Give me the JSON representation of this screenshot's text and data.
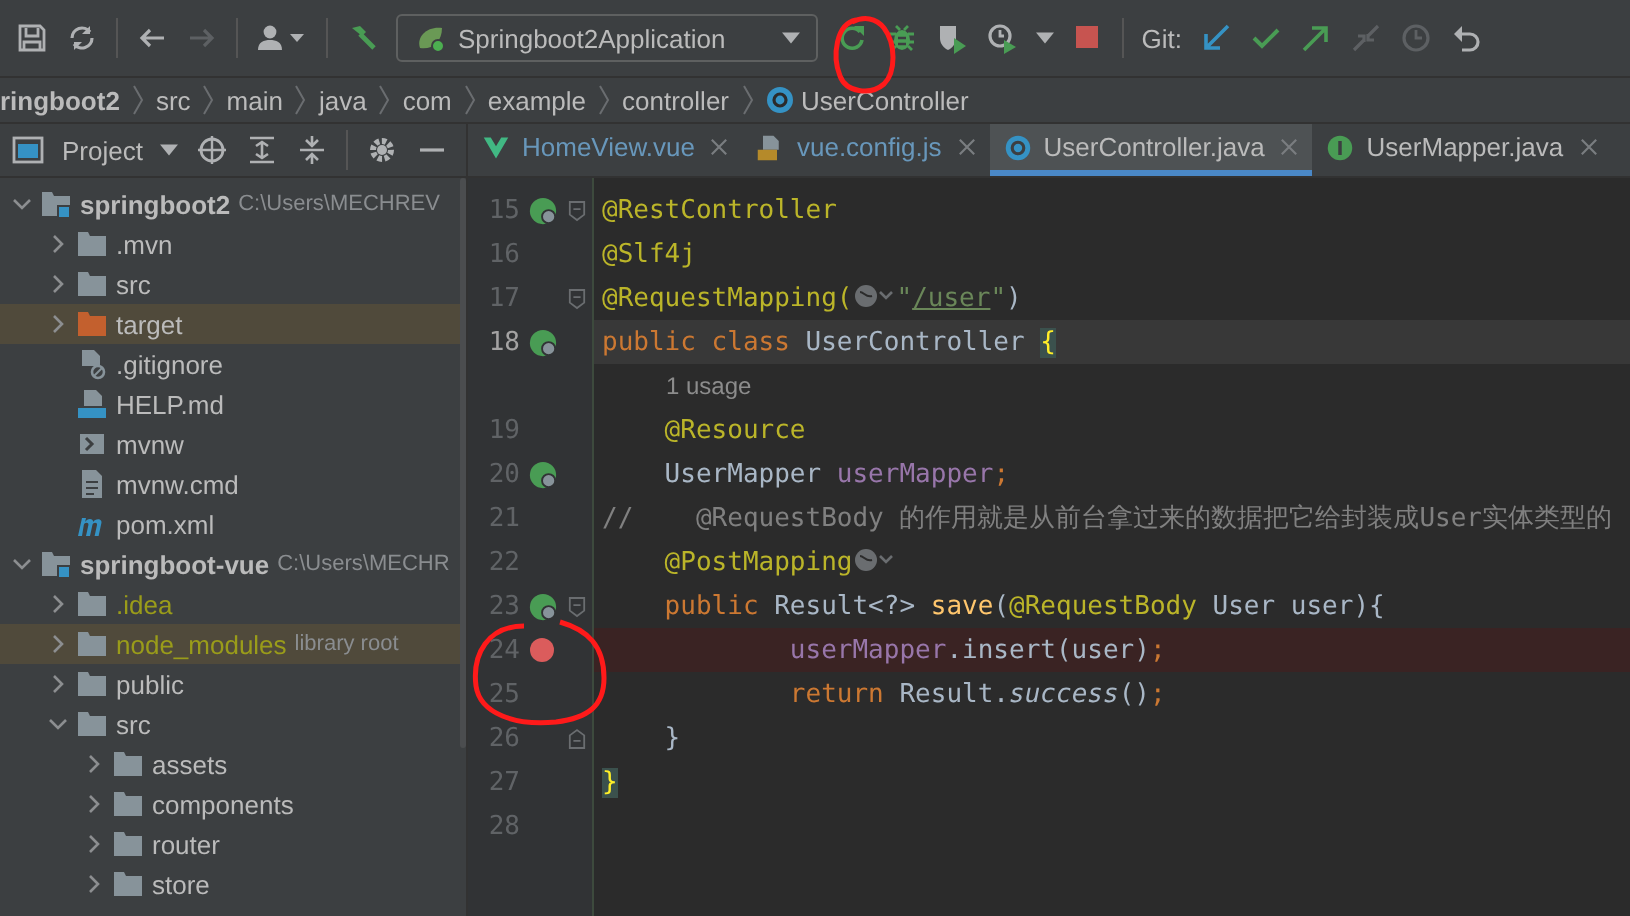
{
  "toolbar": {
    "run_configuration": "Springboot2Application",
    "vcs_label": "Git:"
  },
  "breadcrumbs": [
    {
      "label": "ringboot2",
      "kind": "project"
    },
    {
      "label": "src",
      "kind": "folder"
    },
    {
      "label": "main",
      "kind": "folder"
    },
    {
      "label": "java",
      "kind": "folder"
    },
    {
      "label": "com",
      "kind": "folder"
    },
    {
      "label": "example",
      "kind": "folder"
    },
    {
      "label": "controller",
      "kind": "folder"
    },
    {
      "label": "UserController",
      "kind": "class"
    }
  ],
  "project_panel": {
    "title": "Project"
  },
  "tree": [
    {
      "label": "springboot2",
      "kind": "module",
      "hint": "C:\\Users\\MECHREV",
      "expanded": true,
      "highlighted": false,
      "ignored": false,
      "children": [
        {
          "label": ".mvn",
          "kind": "folder",
          "expanded": false,
          "highlighted": false,
          "ignored": false
        },
        {
          "label": "src",
          "kind": "folder",
          "expanded": false,
          "highlighted": false,
          "ignored": false
        },
        {
          "label": "target",
          "kind": "excluded",
          "expanded": false,
          "highlighted": true,
          "ignored": false
        },
        {
          "label": ".gitignore",
          "kind": "ignore-file",
          "highlighted": false,
          "ignored": false
        },
        {
          "label": "HELP.md",
          "kind": "markdown",
          "highlighted": false,
          "ignored": false
        },
        {
          "label": "mvnw",
          "kind": "shell",
          "highlighted": false,
          "ignored": false
        },
        {
          "label": "mvnw.cmd",
          "kind": "text",
          "highlighted": false,
          "ignored": false
        },
        {
          "label": "pom.xml",
          "kind": "maven",
          "highlighted": false,
          "ignored": false
        }
      ]
    },
    {
      "label": "springboot-vue",
      "kind": "module",
      "hint": "C:\\Users\\MECHR",
      "expanded": true,
      "highlighted": false,
      "ignored": false,
      "children": [
        {
          "label": ".idea",
          "kind": "folder",
          "expanded": false,
          "highlighted": false,
          "ignored": true
        },
        {
          "label": "node_modules",
          "kind": "folder",
          "hint": "library root",
          "expanded": false,
          "highlighted": true,
          "ignored": true
        },
        {
          "label": "public",
          "kind": "folder",
          "expanded": false,
          "highlighted": false,
          "ignored": false
        },
        {
          "label": "src",
          "kind": "folder",
          "expanded": true,
          "highlighted": false,
          "ignored": false,
          "children": [
            {
              "label": "assets",
              "kind": "folder",
              "expanded": false,
              "highlighted": false,
              "ignored": false
            },
            {
              "label": "components",
              "kind": "folder",
              "expanded": false,
              "highlighted": false,
              "ignored": false
            },
            {
              "label": "router",
              "kind": "folder",
              "expanded": false,
              "highlighted": false,
              "ignored": false
            },
            {
              "label": "store",
              "kind": "folder",
              "expanded": false,
              "highlighted": false,
              "ignored": false
            }
          ]
        }
      ]
    }
  ],
  "tabs": [
    {
      "label": "HomeView.vue",
      "kind": "vue",
      "selected": false,
      "modified": true
    },
    {
      "label": "vue.config.js",
      "kind": "js",
      "selected": false,
      "modified": true
    },
    {
      "label": "UserController.java",
      "kind": "class",
      "selected": true,
      "modified": false
    },
    {
      "label": "UserMapper.java",
      "kind": "interface",
      "selected": false,
      "modified": false
    }
  ],
  "editor": {
    "lines": [
      {
        "kind": "code",
        "number": "15",
        "caret": false,
        "breakpoint": false,
        "marker": true,
        "fold_start": true,
        "fold_end": false,
        "tokens": [
          {
            "kind": "annotation",
            "text": "@RestController"
          }
        ]
      },
      {
        "kind": "code",
        "number": "16",
        "caret": false,
        "breakpoint": false,
        "marker": false,
        "fold_start": false,
        "fold_end": false,
        "tokens": [
          {
            "kind": "annotation",
            "text": "@Slf4j"
          }
        ]
      },
      {
        "kind": "code",
        "number": "17",
        "caret": false,
        "breakpoint": false,
        "marker": false,
        "fold_start": true,
        "fold_end": false,
        "tokens": [
          {
            "kind": "annotation",
            "text": "@RequestMapping("
          },
          {
            "kind": "globe"
          },
          {
            "kind": "string",
            "text": "\""
          },
          {
            "kind": "url",
            "text": "/user"
          },
          {
            "kind": "string",
            "text": "\""
          },
          {
            "kind": "plain",
            "text": ")"
          }
        ]
      },
      {
        "kind": "code",
        "number": "18",
        "caret": true,
        "breakpoint": false,
        "marker": true,
        "fold_start": false,
        "fold_end": false,
        "tokens": [
          {
            "kind": "keyword",
            "text": "public class "
          },
          {
            "kind": "plain",
            "text": "UserController "
          },
          {
            "kind": "brace",
            "text": "{"
          }
        ]
      },
      {
        "kind": "inlay",
        "text": "1 usage"
      },
      {
        "kind": "code",
        "number": "19",
        "caret": false,
        "breakpoint": false,
        "marker": false,
        "fold_start": false,
        "fold_end": false,
        "tokens": [
          {
            "kind": "annotation",
            "text": "    @Resource"
          }
        ]
      },
      {
        "kind": "code",
        "number": "20",
        "caret": false,
        "breakpoint": false,
        "marker": true,
        "fold_start": false,
        "fold_end": false,
        "tokens": [
          {
            "kind": "plain",
            "text": "    UserMapper "
          },
          {
            "kind": "field",
            "text": "userMapper"
          },
          {
            "kind": "keyword",
            "text": ";"
          }
        ]
      },
      {
        "kind": "code",
        "number": "21",
        "caret": false,
        "breakpoint": false,
        "marker": false,
        "fold_start": false,
        "fold_end": false,
        "tokens": [
          {
            "kind": "comment",
            "text": "//    @RequestBody 的作用就是从前台拿过来的数据把它给封装成User实体类型的"
          }
        ]
      },
      {
        "kind": "code",
        "number": "22",
        "caret": false,
        "breakpoint": false,
        "marker": false,
        "fold_start": false,
        "fold_end": false,
        "tokens": [
          {
            "kind": "annotation",
            "text": "    @PostMapping"
          },
          {
            "kind": "globe"
          }
        ]
      },
      {
        "kind": "code",
        "number": "23",
        "caret": false,
        "breakpoint": false,
        "marker": true,
        "fold_start": true,
        "fold_end": false,
        "tokens": [
          {
            "kind": "keyword",
            "text": "    public "
          },
          {
            "kind": "plain",
            "text": "Result<?> "
          },
          {
            "kind": "method",
            "text": "save"
          },
          {
            "kind": "plain",
            "text": "("
          },
          {
            "kind": "annotation",
            "text": "@RequestBody"
          },
          {
            "kind": "plain",
            "text": " User user){"
          }
        ]
      },
      {
        "kind": "code",
        "number": "24",
        "caret": false,
        "breakpoint": true,
        "marker": false,
        "fold_start": false,
        "fold_end": false,
        "tokens": [
          {
            "kind": "field",
            "text": "            userMapper"
          },
          {
            "kind": "plain",
            "text": ".insert(user)"
          },
          {
            "kind": "keyword",
            "text": ";"
          }
        ]
      },
      {
        "kind": "code",
        "number": "25",
        "caret": false,
        "breakpoint": false,
        "marker": false,
        "fold_start": false,
        "fold_end": false,
        "tokens": [
          {
            "kind": "keyword",
            "text": "            return "
          },
          {
            "kind": "plain",
            "text": "Result."
          },
          {
            "kind": "static",
            "text": "success"
          },
          {
            "kind": "plain",
            "text": "()"
          },
          {
            "kind": "keyword",
            "text": ";"
          }
        ]
      },
      {
        "kind": "code",
        "number": "26",
        "caret": false,
        "breakpoint": false,
        "marker": false,
        "fold_start": false,
        "fold_end": true,
        "tokens": [
          {
            "kind": "plain",
            "text": "    }"
          }
        ]
      },
      {
        "kind": "code",
        "number": "27",
        "caret": false,
        "breakpoint": false,
        "marker": false,
        "fold_start": false,
        "fold_end": false,
        "tokens": [
          {
            "kind": "brace",
            "text": "}"
          }
        ]
      },
      {
        "kind": "code",
        "number": "28",
        "caret": false,
        "breakpoint": false,
        "marker": false,
        "fold_start": false,
        "fold_end": false
      }
    ]
  }
}
